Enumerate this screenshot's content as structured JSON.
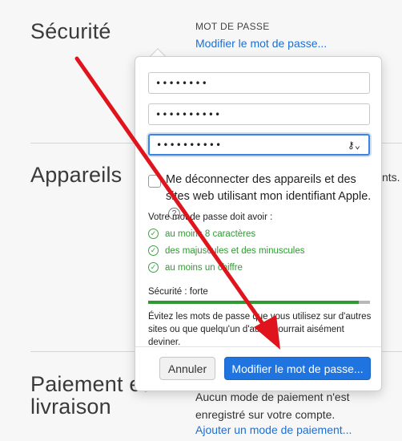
{
  "security": {
    "title": "Sécurité",
    "password_caption": "MOT DE PASSE",
    "change_password_link": "Modifier le mot de passe..."
  },
  "devices": {
    "title": "Appareils",
    "truncated_text": "nts."
  },
  "payment": {
    "title_line1": "Paiement et",
    "title_line2": "livraison",
    "no_payment_text": "Aucun mode de paiement n'est enregistré sur votre compte.",
    "add_payment_link": "Ajouter un mode de paiement..."
  },
  "popover": {
    "fields": [
      {
        "value": "••••••••"
      },
      {
        "value": "••••••••••"
      },
      {
        "value": "••••••••••",
        "icon": "key-icon"
      }
    ],
    "signout_checkbox_label": "Me déconnecter des appareils et des sites web utilisant mon identifiant Apple.",
    "help_glyph": "?",
    "requirements_title": "Votre mot de passe doit avoir :",
    "requirements": [
      "au moins 8 caractères",
      "des majuscules et des minuscules",
      "au moins un chiffre"
    ],
    "check_glyph": "✓",
    "strength_label": "Sécurité : forte",
    "strength_level": 0.95,
    "hint": "Évitez les mots de passe que vous utilisez sur d'autres sites ou que quelqu'un d'autre pourrait aisément deviner.",
    "cancel_label": "Annuler",
    "submit_label": "Modifier le mot de passe...",
    "key_glyph": "⚷⌄"
  },
  "colors": {
    "accent": "#1f74e0",
    "success": "#2f9a32",
    "annotation_arrow": "#e0141c"
  }
}
